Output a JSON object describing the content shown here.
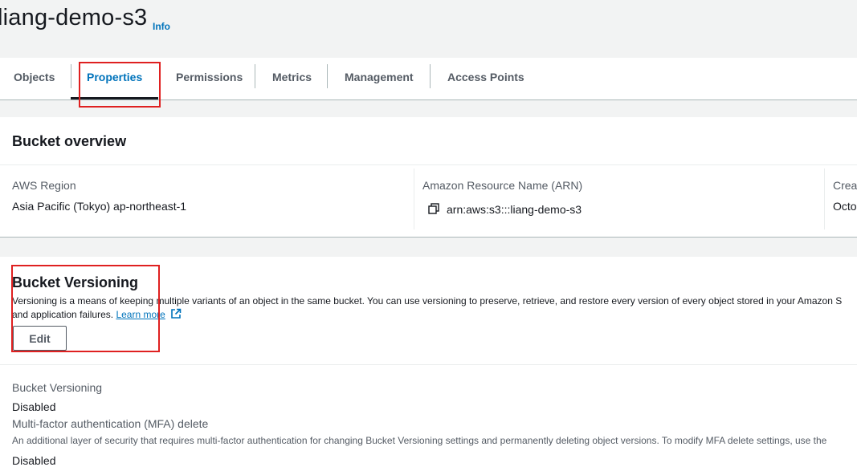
{
  "header": {
    "title": "liang-demo-s3",
    "info_link": "Info"
  },
  "tabs": [
    {
      "label": "Objects",
      "active": false
    },
    {
      "label": "Properties",
      "active": true
    },
    {
      "label": "Permissions",
      "active": false
    },
    {
      "label": "Metrics",
      "active": false
    },
    {
      "label": "Management",
      "active": false
    },
    {
      "label": "Access Points",
      "active": false
    }
  ],
  "bucket_overview": {
    "heading": "Bucket overview",
    "region_label": "AWS Region",
    "region_value": "Asia Pacific (Tokyo) ap-northeast-1",
    "arn_label": "Amazon Resource Name (ARN)",
    "arn_value": "arn:aws:s3:::liang-demo-s3",
    "created_label": "Creat",
    "created_value": "Octo"
  },
  "bucket_versioning": {
    "heading": "Bucket Versioning",
    "description_line1": "Versioning is a means of keeping multiple variants of an object in the same bucket. You can use versioning to preserve, retrieve, and restore every version of every object stored in your Amazon S",
    "description_line2": "and application failures.",
    "learn_more": "Learn more",
    "edit_button": "Edit",
    "status_label": "Bucket Versioning",
    "status_value": "Disabled",
    "mfa_label": "Multi-factor authentication (MFA) delete",
    "mfa_description": "An additional layer of security that requires multi-factor authentication for changing Bucket Versioning settings and permanently deleting object versions. To modify MFA delete settings, use the",
    "mfa_value": "Disabled"
  },
  "colors": {
    "accent": "#0073bb",
    "highlight": "#df2020"
  }
}
